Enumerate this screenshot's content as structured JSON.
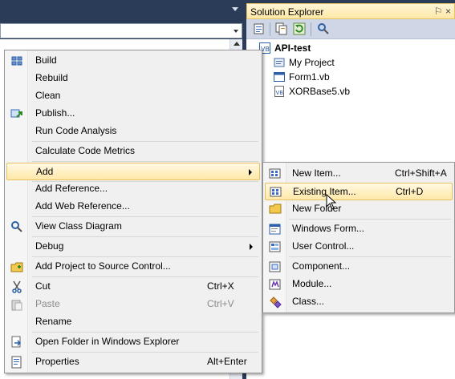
{
  "solution_explorer": {
    "title": "Solution Explorer",
    "pin_glyph": "⚐ ×",
    "tree": {
      "root": "API-test",
      "items": [
        "My Project",
        "Form1.vb",
        "XORBase5.vb"
      ]
    }
  },
  "context_menu": {
    "items": {
      "build": "Build",
      "rebuild": "Rebuild",
      "clean": "Clean",
      "publish": "Publish...",
      "run_code_analysis": "Run Code Analysis",
      "calculate_code_metrics": "Calculate Code Metrics",
      "add": "Add",
      "add_reference": "Add Reference...",
      "add_web_reference": "Add Web Reference...",
      "view_class_diagram": "View Class Diagram",
      "debug": "Debug",
      "add_project_to_source_control": "Add Project to Source Control...",
      "cut": "Cut",
      "cut_shortcut": "Ctrl+X",
      "paste": "Paste",
      "paste_shortcut": "Ctrl+V",
      "rename": "Rename",
      "open_folder": "Open Folder in Windows Explorer",
      "properties": "Properties",
      "properties_shortcut": "Alt+Enter"
    }
  },
  "add_submenu": {
    "items": {
      "new_item": "New Item...",
      "new_item_shortcut": "Ctrl+Shift+A",
      "existing_item": "Existing Item...",
      "existing_item_shortcut": "Ctrl+D",
      "new_folder": "New Folder",
      "windows_form": "Windows Form...",
      "user_control": "User Control...",
      "component": "Component...",
      "module": "Module...",
      "class": "Class..."
    }
  },
  "colors": {
    "ide_background": "#2b3c59",
    "highlight_fill": "#ffe8a8",
    "highlight_border": "#e6c060",
    "menu_background": "#f0f0f0"
  }
}
